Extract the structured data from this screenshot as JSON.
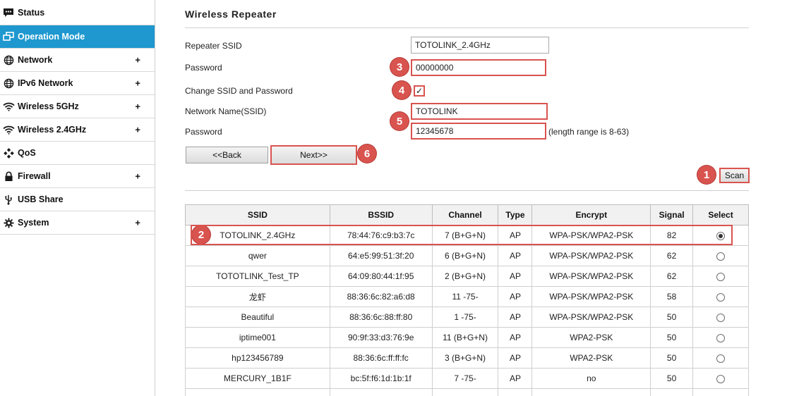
{
  "sidebar": {
    "items": [
      {
        "label": "Status",
        "icon": "chat-bubble-icon",
        "plus": "",
        "active": false
      },
      {
        "label": "Operation Mode",
        "icon": "window-swap-icon",
        "plus": "",
        "active": true
      },
      {
        "label": "Network",
        "icon": "globe-icon",
        "plus": "+",
        "active": false
      },
      {
        "label": "IPv6 Network",
        "icon": "globe-icon",
        "plus": "+",
        "active": false
      },
      {
        "label": "Wireless 5GHz",
        "icon": "wifi-icon",
        "plus": "+",
        "active": false
      },
      {
        "label": "Wireless 2.4GHz",
        "icon": "wifi-icon",
        "plus": "+",
        "active": false
      },
      {
        "label": "QoS",
        "icon": "diamond-dots-icon",
        "plus": "",
        "active": false
      },
      {
        "label": "Firewall",
        "icon": "lock-icon",
        "plus": "+",
        "active": false
      },
      {
        "label": "USB Share",
        "icon": "usb-icon",
        "plus": "",
        "active": false
      },
      {
        "label": "System",
        "icon": "gear-icon",
        "plus": "+",
        "active": false
      }
    ],
    "active_color": "#1e98cf"
  },
  "page": {
    "title": "Wireless Repeater"
  },
  "form": {
    "repeater_ssid_label": "Repeater SSID",
    "repeater_ssid_value": "TOTOLINK_2.4GHz",
    "password_label": "Password",
    "password_value": "00000000",
    "change_label": "Change SSID and Password",
    "change_checked": true,
    "check_mark": "✓",
    "network_name_label": "Network Name(SSID)",
    "network_name_value": "TOTOLINK",
    "new_password_label": "Password",
    "new_password_value": "12345678",
    "length_hint": "(length range is 8-63)"
  },
  "buttons": {
    "back": "<<Back",
    "next": "Next>>",
    "scan": "Scan"
  },
  "annotations": {
    "color": "#d9534f",
    "badges": [
      "1",
      "2",
      "3",
      "4",
      "5",
      "6"
    ]
  },
  "table": {
    "headers": [
      "SSID",
      "BSSID",
      "Channel",
      "Type",
      "Encrypt",
      "Signal",
      "Select"
    ],
    "rows": [
      {
        "ssid": "TOTOLINK_2.4GHz",
        "bssid": "78:44:76:c9:b3:7c",
        "channel": "7 (B+G+N)",
        "type": "AP",
        "encrypt": "WPA-PSK/WPA2-PSK",
        "signal": "82",
        "selected": true
      },
      {
        "ssid": "qwer",
        "bssid": "64:e5:99:51:3f:20",
        "channel": "6 (B+G+N)",
        "type": "AP",
        "encrypt": "WPA-PSK/WPA2-PSK",
        "signal": "62",
        "selected": false
      },
      {
        "ssid": "TOTOTLINK_Test_TP",
        "bssid": "64:09:80:44:1f:95",
        "channel": "2 (B+G+N)",
        "type": "AP",
        "encrypt": "WPA-PSK/WPA2-PSK",
        "signal": "62",
        "selected": false
      },
      {
        "ssid": "龙虾",
        "bssid": "88:36:6c:82:a6:d8",
        "channel": "11 -75-",
        "type": "AP",
        "encrypt": "WPA-PSK/WPA2-PSK",
        "signal": "58",
        "selected": false
      },
      {
        "ssid": "Beautiful",
        "bssid": "88:36:6c:88:ff:80",
        "channel": "1 -75-",
        "type": "AP",
        "encrypt": "WPA-PSK/WPA2-PSK",
        "signal": "50",
        "selected": false
      },
      {
        "ssid": "iptime001",
        "bssid": "90:9f:33:d3:76:9e",
        "channel": "11 (B+G+N)",
        "type": "AP",
        "encrypt": "WPA2-PSK",
        "signal": "50",
        "selected": false
      },
      {
        "ssid": "hp123456789",
        "bssid": "88:36:6c:ff:ff:fc",
        "channel": "3 (B+G+N)",
        "type": "AP",
        "encrypt": "WPA2-PSK",
        "signal": "50",
        "selected": false
      },
      {
        "ssid": "MERCURY_1B1F",
        "bssid": "bc:5f:f6:1d:1b:1f",
        "channel": "7 -75-",
        "type": "AP",
        "encrypt": "no",
        "signal": "50",
        "selected": false
      }
    ]
  }
}
